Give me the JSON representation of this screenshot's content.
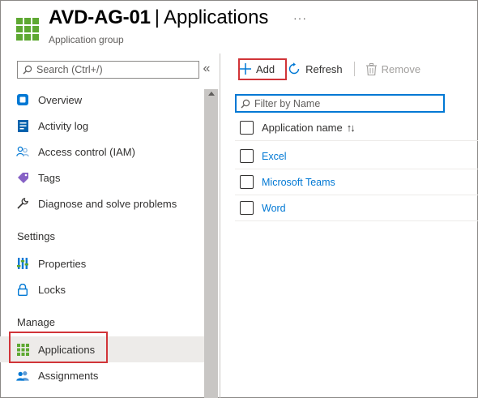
{
  "header": {
    "title_name": "AVD-AG-01",
    "title_sep": "|",
    "title_page": "Applications",
    "subtitle": "Application group",
    "more_label": "···"
  },
  "sidebar": {
    "search_placeholder": "Search (Ctrl+/)",
    "collapse_label": "«",
    "items_top": [
      {
        "label": "Overview",
        "icon": "overview-icon"
      },
      {
        "label": "Activity log",
        "icon": "activity-log-icon"
      },
      {
        "label": "Access control (IAM)",
        "icon": "people-icon"
      },
      {
        "label": "Tags",
        "icon": "tag-icon"
      },
      {
        "label": "Diagnose and solve problems",
        "icon": "wrench-icon"
      }
    ],
    "settings_header": "Settings",
    "settings_items": [
      {
        "label": "Properties",
        "icon": "properties-icon"
      },
      {
        "label": "Locks",
        "icon": "lock-icon"
      }
    ],
    "manage_header": "Manage",
    "manage_items": [
      {
        "label": "Applications",
        "icon": "grid-icon",
        "selected": true
      },
      {
        "label": "Assignments",
        "icon": "users-icon"
      }
    ]
  },
  "toolbar": {
    "add_label": "Add",
    "refresh_label": "Refresh",
    "remove_label": "Remove"
  },
  "filter": {
    "placeholder": "Filter by Name"
  },
  "table": {
    "column_header": "Application name",
    "sort_glyph": "↑↓",
    "rows": [
      "Excel",
      "Microsoft Teams",
      "Word"
    ]
  },
  "colors": {
    "accent": "#0078d4",
    "highlight": "#d13438",
    "brand_green": "#5ea832"
  }
}
